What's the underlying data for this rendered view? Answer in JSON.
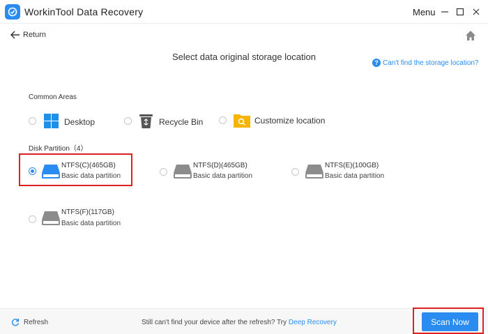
{
  "app": {
    "title": "WorkinTool Data Recovery",
    "menu_label": "Menu"
  },
  "nav": {
    "return_label": "Return"
  },
  "page": {
    "title": "Select data original storage location",
    "help_link": "Can't find the storage location?"
  },
  "common_areas": {
    "label": "Common Areas",
    "items": [
      {
        "label": "Desktop",
        "icon": "windows-icon"
      },
      {
        "label": "Recycle Bin",
        "icon": "recycle-bin-icon"
      },
      {
        "label": "Customize location",
        "icon": "folder-search-icon"
      }
    ]
  },
  "disk_partition": {
    "label": "Disk Partition（4）",
    "items": [
      {
        "name": "NTFS(C)(465GB)",
        "sub": "Basic data partition",
        "selected": true
      },
      {
        "name": "NTFS(D)(465GB)",
        "sub": "Basic data partition",
        "selected": false
      },
      {
        "name": "NTFS(E)(100GB)",
        "sub": "Basic data partition",
        "selected": false
      },
      {
        "name": "NTFS(F)(117GB)",
        "sub": "Basic data partition",
        "selected": false
      }
    ]
  },
  "footer": {
    "refresh_label": "Refresh",
    "message": "Still can't find your device after the refresh? Try ",
    "link": "Deep Recovery",
    "scan_button": "Scan Now"
  },
  "colors": {
    "accent": "#2a8cf0",
    "highlight": "#e02020",
    "drive_gray": "#8c8c8c"
  }
}
